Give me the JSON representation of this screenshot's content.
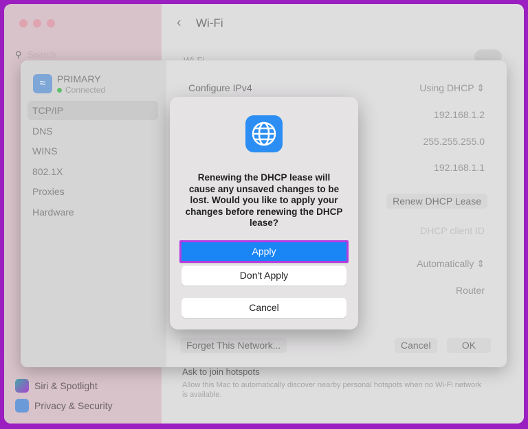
{
  "background_window": {
    "sidebar": {
      "search_placeholder": "Search",
      "items": [
        {
          "label": "Siri & Spotlight"
        },
        {
          "label": "Privacy & Security"
        }
      ]
    },
    "title": "Wi-Fi",
    "wifi_row_label": "Wi-Fi",
    "hotspots": {
      "title": "Ask to join hotspots",
      "description": "Allow this Mac to automatically discover nearby personal hotspots when no Wi-Fi network is available."
    }
  },
  "sheet": {
    "network": {
      "name": "PRIMARY",
      "status": "Connected"
    },
    "tabs": [
      {
        "label": "TCP/IP"
      },
      {
        "label": "DNS"
      },
      {
        "label": "WINS"
      },
      {
        "label": "802.1X"
      },
      {
        "label": "Proxies"
      },
      {
        "label": "Hardware"
      }
    ],
    "configure_ipv4": {
      "label": "Configure IPv4",
      "value": "Using DHCP"
    },
    "ip_address": "192.168.1.2",
    "subnet_mask": "255.255.255.0",
    "router": "192.168.1.1",
    "renew_button": "Renew DHCP Lease",
    "dhcp_client_id_placeholder": "DHCP client ID",
    "configure_ipv6_value": "Automatically",
    "ipv6_router": "Router",
    "forget_button": "Forget This Network...",
    "cancel_button": "Cancel",
    "ok_button": "OK"
  },
  "dialog": {
    "icon": "globe-icon",
    "message": "Renewing the DHCP lease will cause any unsaved changes to be lost. Would you like to apply your changes before renewing the DHCP lease?",
    "apply": "Apply",
    "dont_apply": "Don't Apply",
    "cancel": "Cancel"
  },
  "colors": {
    "accent": "#1a85f5",
    "highlight": "#b43ee0",
    "frame": "#9b1fc0"
  }
}
